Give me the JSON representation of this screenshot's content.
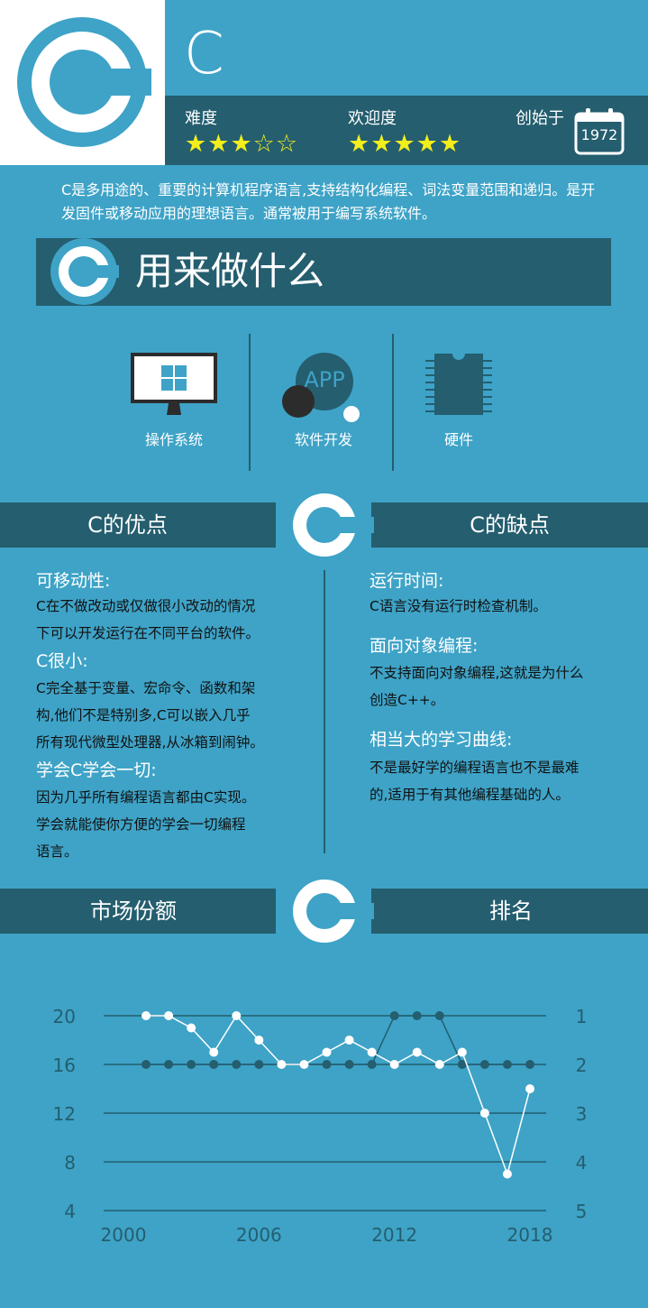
{
  "header": {
    "title": "C",
    "difficulty_label": "难度",
    "difficulty_rating": 3,
    "popularity_label": "欢迎度",
    "popularity_rating": 5,
    "founded_label": "创始于",
    "founded_year": "1972"
  },
  "description": "C是多用途的、重要的计算机程序语言,支持结构化编程、词法变量范围和递归。是开发固件或移动应用的理想语言。通常被用于编写系统软件。",
  "uses": {
    "title": "用来做什么",
    "items": [
      {
        "label": "操作系统",
        "icon": "windows-monitor-icon"
      },
      {
        "label": "软件开发",
        "icon": "app-icon",
        "icon_text": "APP"
      },
      {
        "label": "硬件",
        "icon": "chip-icon"
      }
    ]
  },
  "pros": {
    "title": "C的优点",
    "items": [
      {
        "heading": "可移动性:",
        "lines": [
          "C在不做改动或仅做很小改动的情况",
          "下可以开发运行在不同平台的软件。"
        ]
      },
      {
        "heading": "C很小:",
        "lines": [
          "C完全基于变量、宏命令、函数和架",
          "构,他们不是特别多,C可以嵌入几乎",
          "所有现代微型处理器,从冰箱到闹钟。"
        ]
      },
      {
        "heading": "学会C学会一切:",
        "lines": [
          "因为几乎所有编程语言都由C实现。",
          "学会就能使你方便的学会一切编程",
          "语言。"
        ]
      }
    ]
  },
  "cons": {
    "title": "C的缺点",
    "items": [
      {
        "heading": "运行时间:",
        "lines": [
          "C语言没有运行时检查机制。"
        ]
      },
      {
        "heading": "面向对象编程:",
        "lines": [
          "不支持面向对象编程,这就是为什么",
          "创造C++。"
        ]
      },
      {
        "heading": "相当大的学习曲线:",
        "lines": [
          "不是最好学的编程语言也不是最难",
          "的,适用于有其他编程基础的人。"
        ]
      }
    ]
  },
  "chart_titles": {
    "left": "市场份额",
    "right": "排名"
  },
  "chart_data": {
    "type": "line",
    "x": [
      2001,
      2002,
      2003,
      2004,
      2005,
      2006,
      2007,
      2008,
      2009,
      2010,
      2011,
      2012,
      2013,
      2014,
      2015,
      2016,
      2017,
      2018
    ],
    "xticks": [
      "2000",
      "2006",
      "2012",
      "2018"
    ],
    "xlim": [
      2000,
      2018
    ],
    "left_axis": {
      "ticks": [
        "20",
        "16",
        "12",
        "8",
        "4"
      ],
      "ylim": [
        4,
        20
      ]
    },
    "right_axis": {
      "ticks": [
        "1",
        "2",
        "3",
        "4",
        "5"
      ],
      "ylim": [
        5,
        1
      ]
    },
    "series": [
      {
        "axis": "left",
        "color": "#ffffff",
        "values": [
          20,
          20,
          19,
          17,
          20,
          18,
          16,
          16,
          17,
          18,
          17,
          16,
          17,
          16,
          17,
          12,
          7,
          14
        ]
      },
      {
        "axis": "right",
        "color": "#245e6f",
        "values": [
          2,
          2,
          2,
          2,
          2,
          2,
          2,
          2,
          2,
          2,
          2,
          1,
          1,
          1,
          2,
          2,
          2,
          2
        ]
      }
    ],
    "grid": true
  },
  "colors": {
    "background": "#3ea3c7",
    "dark": "#245e6f",
    "star": "#f3ee1c",
    "white": "#ffffff"
  }
}
